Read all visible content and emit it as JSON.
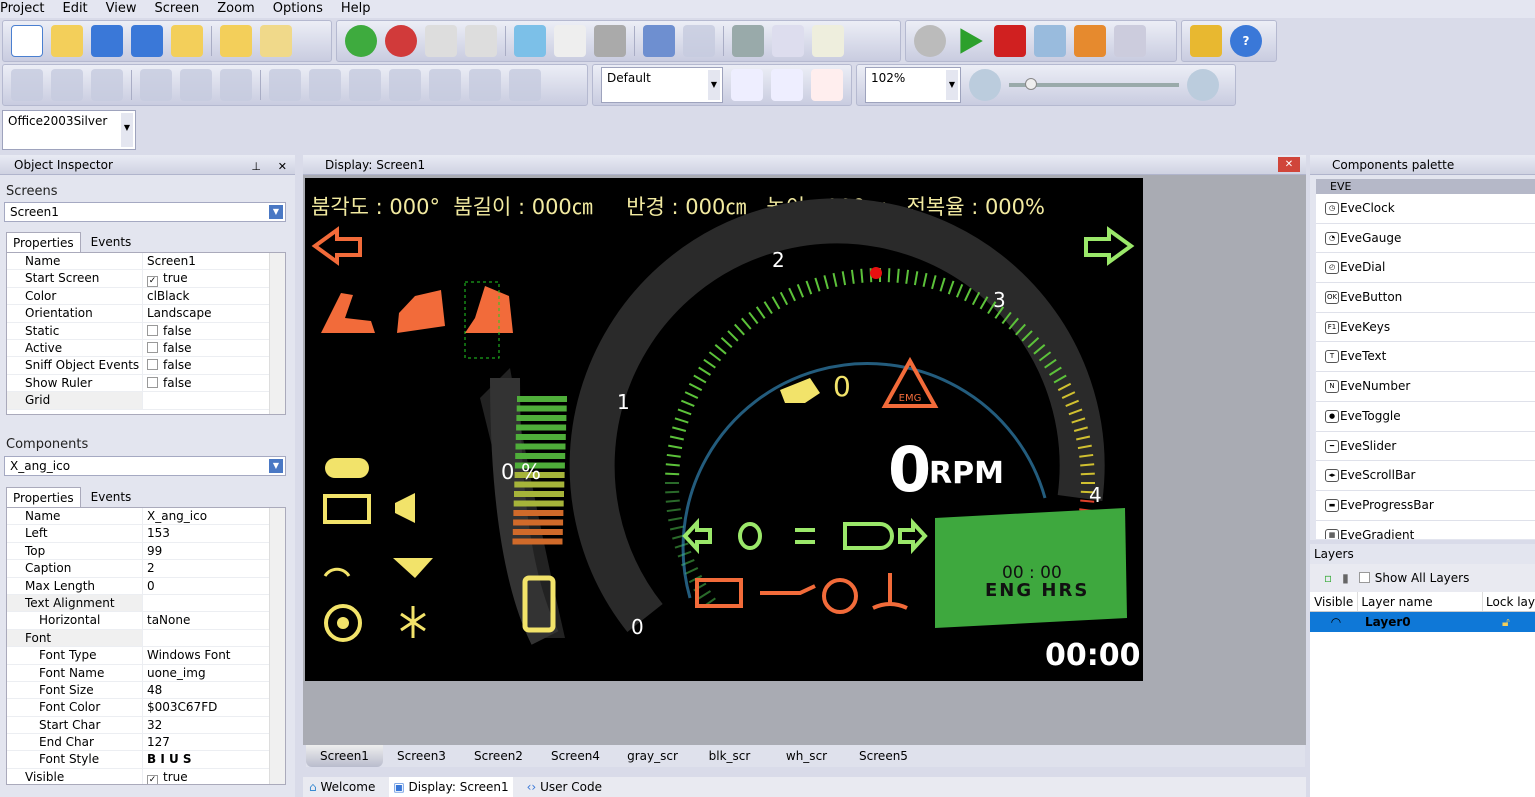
{
  "menu": [
    "Project",
    "Edit",
    "View",
    "Screen",
    "Zoom",
    "Options",
    "Help"
  ],
  "toolbar": {
    "font_combo": "Default",
    "zoom_combo": "102%",
    "theme_combo": "Office2003Silver"
  },
  "object_inspector": {
    "title": "Object Inspector",
    "screens_label": "Screens",
    "screen_value": "Screen1",
    "tab_properties": "Properties",
    "tab_events": "Events",
    "screen_props": [
      [
        "Name",
        "Screen1",
        ""
      ],
      [
        "Start Screen",
        "true",
        "checked"
      ],
      [
        "Color",
        "clBlack",
        ""
      ],
      [
        "Orientation",
        "Landscape",
        ""
      ],
      [
        "Static",
        "false",
        "unchecked"
      ],
      [
        "Active",
        "false",
        "unchecked"
      ],
      [
        "Sniff Object Events",
        "false",
        "unchecked"
      ],
      [
        "Show Ruler",
        "false",
        "unchecked"
      ],
      [
        "Grid",
        "",
        "group"
      ]
    ],
    "components_label": "Components",
    "component_value": "X_ang_ico",
    "component_props": [
      [
        "Name",
        "X_ang_ico",
        ""
      ],
      [
        "Left",
        "153",
        ""
      ],
      [
        "Top",
        "99",
        ""
      ],
      [
        "Caption",
        "2",
        ""
      ],
      [
        "Max Length",
        "0",
        ""
      ],
      [
        "Text Alignment",
        "",
        "group"
      ],
      [
        "Horizontal",
        "taNone",
        "sub"
      ],
      [
        "Font",
        "",
        "group"
      ],
      [
        "Font Type",
        "Windows Font",
        "sub"
      ],
      [
        "Font Name",
        "uone_img",
        "sub"
      ],
      [
        "Font Size",
        "48",
        "sub"
      ],
      [
        "Font Color",
        "$003C67FD",
        "sub"
      ],
      [
        "Start Char",
        "32",
        "sub"
      ],
      [
        "End Char",
        "127",
        "sub"
      ],
      [
        "Font Style",
        "B I U S",
        "sub"
      ],
      [
        "Visible",
        "true",
        "checked"
      ]
    ]
  },
  "display": {
    "title": "Display: Screen1",
    "header_text": [
      "붐각도 : 000°",
      "붐길이 : 000㎝",
      "반경 : 000㎝",
      "높이 : 000㎝",
      "전복율 : 000%"
    ],
    "gauge_ticks": [
      "0",
      "1",
      "2",
      "3",
      "4"
    ],
    "rpm_value": "0",
    "rpm_unit": "RPM",
    "fuel_percent": "0 %",
    "count_value": "0",
    "emg_label": "EMG",
    "eng_time": "00 : 00",
    "eng_label": "ENG HRS",
    "clock": "00:00",
    "colors": {
      "text": "#f2eaa0",
      "orange": "#f26b3a",
      "green": "#9be86a",
      "yellow": "#f2e36a"
    }
  },
  "screen_tabs": [
    "Screen1",
    "Screen3",
    "Screen2",
    "Screen4",
    "gray_scr",
    "blk_scr",
    "wh_scr",
    "Screen5"
  ],
  "doc_tabs": [
    "Welcome",
    "Display: Screen1",
    "User Code"
  ],
  "palette": {
    "title": "Components palette",
    "group": "EVE",
    "items": [
      [
        "EveClock",
        "◷"
      ],
      [
        "EveGauge",
        "◔"
      ],
      [
        "EveDial",
        "◴"
      ],
      [
        "EveButton",
        "OK"
      ],
      [
        "EveKeys",
        "F1"
      ],
      [
        "EveText",
        "T"
      ],
      [
        "EveNumber",
        "N"
      ],
      [
        "EveToggle",
        "●"
      ],
      [
        "EveSlider",
        "━"
      ],
      [
        "EveScrollBar",
        "◂▸"
      ],
      [
        "EveProgressBar",
        "▬"
      ],
      [
        "EveGradient",
        "▦"
      ]
    ]
  },
  "layers": {
    "title": "Layers",
    "show_all": "Show All Layers",
    "col_visible": "Visible",
    "col_name": "Layer name",
    "col_lock": "Lock lay",
    "rows": [
      {
        "name": "Layer0"
      }
    ]
  }
}
